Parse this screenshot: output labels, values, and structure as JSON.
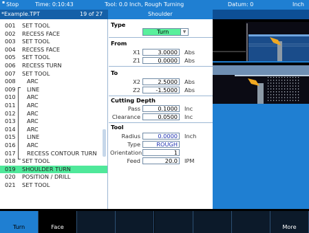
{
  "status": {
    "mode": "Stop",
    "time": "Time: 0:10:43",
    "tool": "Tool: 0.0 Inch, Rough Turning",
    "datum": "Datum: 0",
    "units": "Inch"
  },
  "title": {
    "file": "*Example.TPT",
    "position": "19 of 27",
    "operation": "Shoulder"
  },
  "program_rows": [
    {
      "num": "001",
      "text": "SET TOOL"
    },
    {
      "num": "002",
      "text": "RECESS FACE"
    },
    {
      "num": "003",
      "text": "SET TOOL"
    },
    {
      "num": "004",
      "text": "RECESS FACE"
    },
    {
      "num": "005",
      "text": "SET TOOL"
    },
    {
      "num": "006",
      "text": "RECESS TURN"
    },
    {
      "num": "007",
      "text": "SET TOOL"
    },
    {
      "num": "008",
      "text": "ARC"
    },
    {
      "num": "009",
      "text": "LINE"
    },
    {
      "num": "010",
      "text": "ARC"
    },
    {
      "num": "011",
      "text": "ARC"
    },
    {
      "num": "012",
      "text": "ARC"
    },
    {
      "num": "013",
      "text": "ARC"
    },
    {
      "num": "014",
      "text": "ARC"
    },
    {
      "num": "015",
      "text": "LINE"
    },
    {
      "num": "016",
      "text": "ARC"
    },
    {
      "num": "017",
      "text": "RECESS CONTOUR TURN"
    },
    {
      "num": "018",
      "text": "SET TOOL"
    },
    {
      "num": "019",
      "text": "SHOULDER TURN"
    },
    {
      "num": "020",
      "text": "POSITION / DRILL"
    },
    {
      "num": "021",
      "text": "SET TOOL"
    }
  ],
  "selected_row_index": 18,
  "form": {
    "type": {
      "title": "Type",
      "value": "Turn"
    },
    "from": {
      "title": "From",
      "x1_label": "X1",
      "x1": "3.0000",
      "x1_unit": "Abs",
      "z1_label": "Z1",
      "z1": "0.0000",
      "z1_unit": "Abs"
    },
    "to": {
      "title": "To",
      "x2_label": "X2",
      "x2": "2.5000",
      "x2_unit": "Abs",
      "z2_label": "Z2",
      "z2": "-1.5000",
      "z2_unit": "Abs"
    },
    "depth": {
      "title": "Cutting Depth",
      "pass_label": "Pass",
      "pass": "0.1000",
      "pass_unit": "Inc",
      "clearance_label": "Clearance",
      "clearance": "0.0500",
      "clearance_unit": "Inc"
    },
    "tool": {
      "title": "Tool",
      "radius_label": "Radius",
      "radius": "0.0000",
      "radius_unit": "Inch",
      "type_label": "Type",
      "type": "ROUGH",
      "orientation_label": "Orientation",
      "orientation": "1",
      "feed_label": "Feed",
      "feed": "20.0",
      "feed_unit": "IPM"
    }
  },
  "softkeys": [
    {
      "label": "Turn",
      "active": true
    },
    {
      "label": "Face",
      "active": false
    },
    {
      "label": "",
      "active": false
    },
    {
      "label": "",
      "active": false
    },
    {
      "label": "",
      "active": false
    },
    {
      "label": "",
      "active": false
    },
    {
      "label": "",
      "active": false
    },
    {
      "label": "More",
      "active": false
    }
  ],
  "colors": {
    "accent": "#1f7fd2",
    "selection": "#4fe89a",
    "tool": "#e8a020"
  }
}
